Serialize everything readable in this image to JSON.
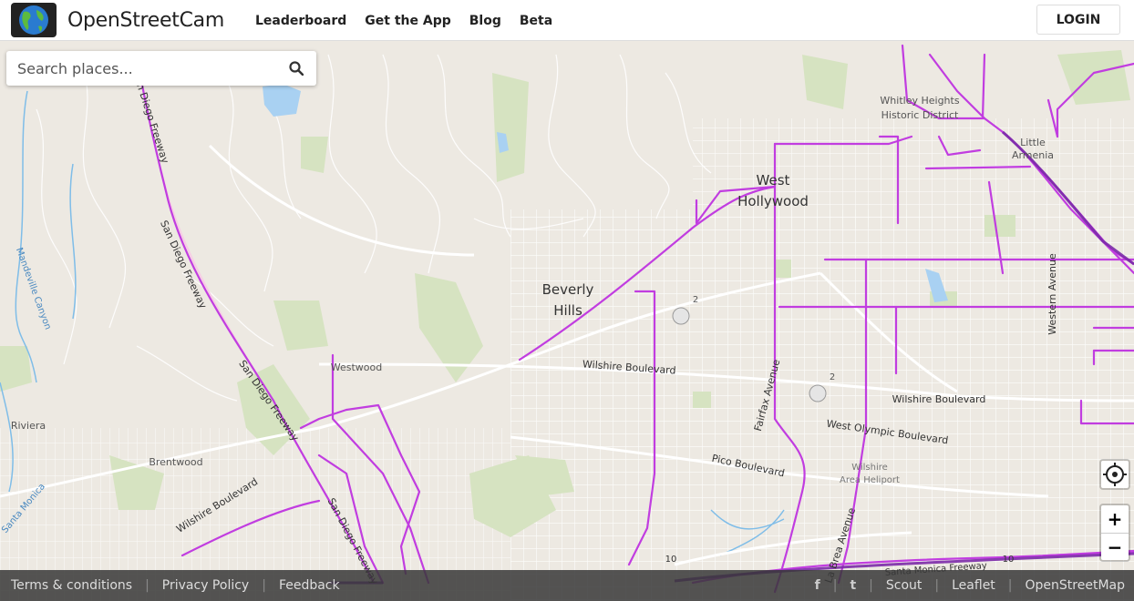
{
  "brand": {
    "name": "OpenStreetCam"
  },
  "nav": {
    "items": [
      "Leaderboard",
      "Get the App",
      "Blog",
      "Beta"
    ]
  },
  "login": {
    "label": "LOGIN"
  },
  "search": {
    "placeholder": "Search places..."
  },
  "map_labels": {
    "west_hollywood": [
      "West",
      "Hollywood"
    ],
    "beverly_hills": [
      "Beverly",
      "Hills"
    ],
    "whitley_heights": [
      "Whitley Heights",
      "Historic District"
    ],
    "little_armenia": [
      "Little",
      "Armenia"
    ],
    "westwood": "Westwood",
    "brentwood": "Brentwood",
    "riviera": "Riviera",
    "wilshire_blvd_1": "Wilshire Boulevard",
    "wilshire_blvd_2": "Wilshire Boulevard",
    "wilshire_blvd_3": "Wilshire Boulevard",
    "west_olympic_blvd": "West Olympic Boulevard",
    "pico_blvd": "Pico Boulevard",
    "fairfax_ave": "Fairfax Avenue",
    "la_brea_ave": "La Brea Avenue",
    "western_ave": "Western Avenue",
    "san_diego_fwy_1": "San Diego Freeway",
    "san_diego_fwy_2": "San Diego Freeway",
    "san_diego_fwy_3": "San Diego Freeway",
    "san_diego_fwy_4": "San Diego Freeway",
    "santa_monica_fwy": "Santa Monica Freeway",
    "wilshire_heliport": [
      "Wilshire",
      "Area Heliport"
    ],
    "mandeville_canyon": "Mandeville Canyon",
    "santa_monica_label": "Santa Monica",
    "marker_2a": "2",
    "marker_2b": "2",
    "route_10a": "10",
    "route_10b": "10"
  },
  "controls": {
    "zoom_in": "+",
    "zoom_out": "−"
  },
  "footer": {
    "links": [
      "Terms & conditions",
      "Privacy Policy",
      "Feedback"
    ],
    "right_links": [
      "Scout",
      "Leaflet",
      "OpenStreetMap"
    ],
    "social": {
      "facebook": "f",
      "twitter": "t"
    }
  },
  "colors": {
    "track": "#c13de0",
    "track_dark": "#7b2aa8",
    "park": "#d6e3c1",
    "water": "#a9d1f2",
    "land": "#f2efe9"
  }
}
